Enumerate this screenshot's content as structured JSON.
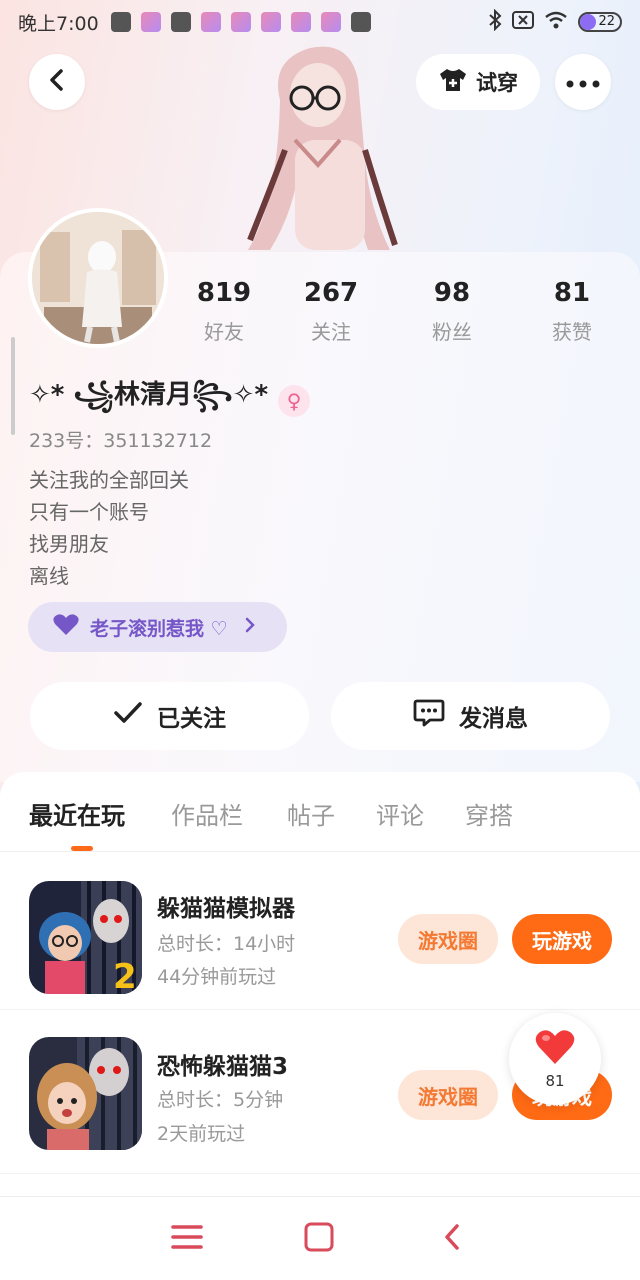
{
  "status_bar": {
    "time": "晚上7:00",
    "battery": "22"
  },
  "header": {
    "tryon_label": "试穿"
  },
  "profile": {
    "stats": [
      {
        "value": "819",
        "label": "好友"
      },
      {
        "value": "267",
        "label": "关注"
      },
      {
        "value": "98",
        "label": "粉丝"
      },
      {
        "value": "81",
        "label": "获赞"
      }
    ],
    "username": "✧* ꧁林清月꧂✧*",
    "account_id": "233号：351132712",
    "bio": [
      "关注我的全部回关",
      "只有一个账号",
      "找男朋友",
      "离线"
    ],
    "tag": "老子滚别惹我 ♡"
  },
  "actions": {
    "follow_label": "已关注",
    "message_label": "发消息"
  },
  "tabs": [
    "最近在玩",
    "作品栏",
    "帖子",
    "评论",
    "穿搭"
  ],
  "games": [
    {
      "title": "躲猫猫模拟器",
      "duration": "总时长：14小时",
      "last_played": "44分钟前玩过",
      "circle_label": "游戏圈",
      "play_label": "玩游戏"
    },
    {
      "title": "恐怖躲猫猫3",
      "duration": "总时长：5分钟",
      "last_played": "2天前玩过",
      "circle_label": "游戏圈",
      "play_label": "玩游戏"
    }
  ],
  "like_float": {
    "count": "81"
  },
  "colors": {
    "accent_orange": "#ff6a14",
    "tag_purple": "#7557c8",
    "like_red": "#f23a3a"
  }
}
